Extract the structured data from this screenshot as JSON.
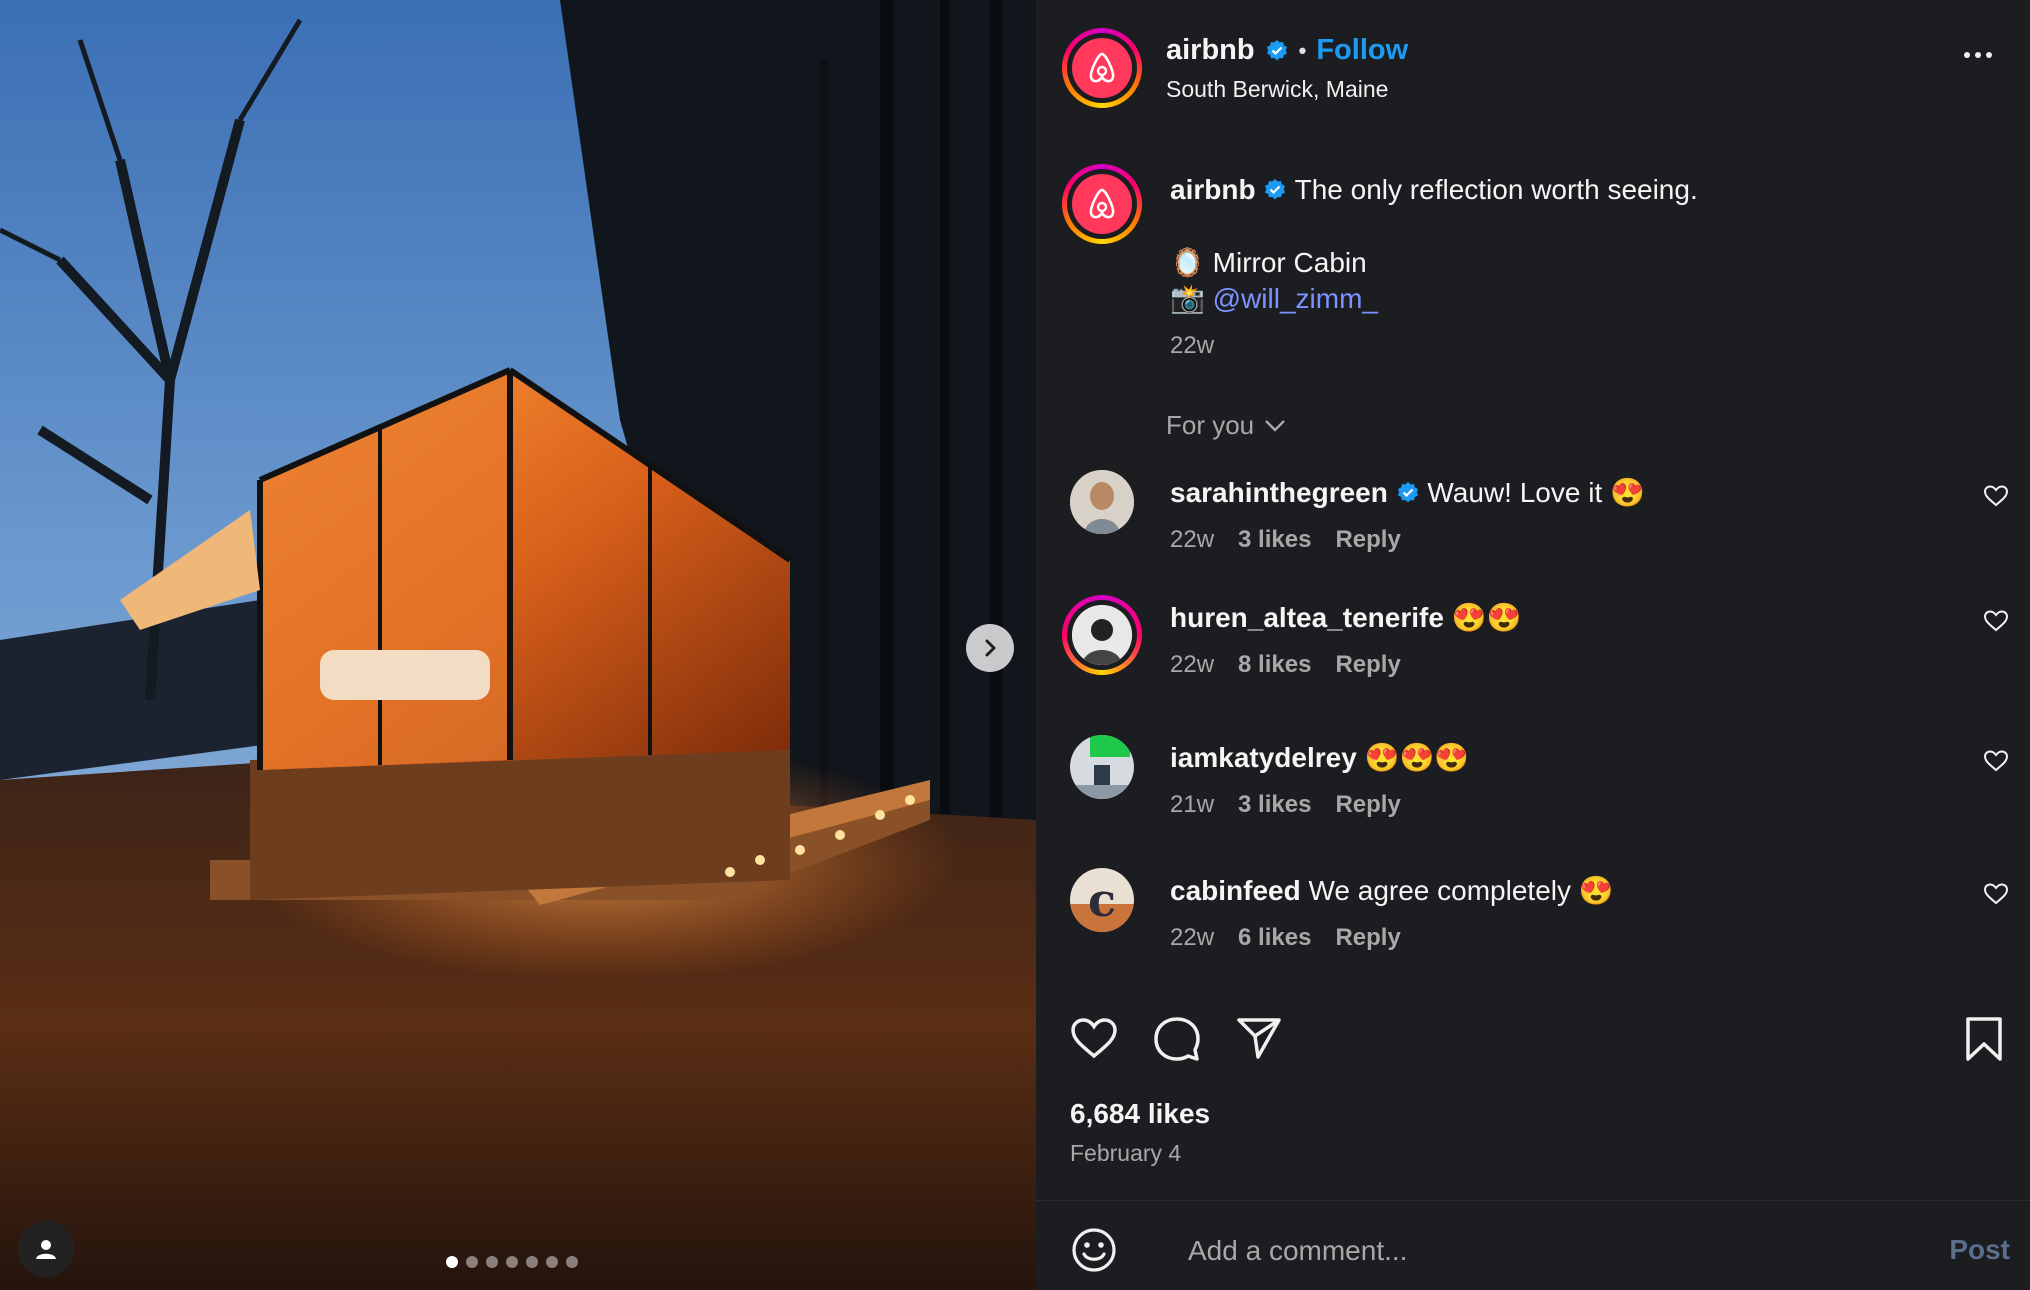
{
  "post": {
    "username": "airbnb",
    "verified": true,
    "follow_label": "Follow",
    "location": "South Berwick, Maine",
    "caption": {
      "text": "The only reflection worth seeing.",
      "line1_emoji": "🪞",
      "line1_text": "Mirror Cabin",
      "line2_emoji": "📸",
      "line2_handle": "@will_zimm_",
      "age": "22w"
    },
    "sort_label": "For you",
    "likes": "6,684 likes",
    "date": "February 4"
  },
  "comments": [
    {
      "username": "sarahinthegreen",
      "verified": true,
      "text": "Wauw! Love it 😍",
      "age": "22w",
      "likes": "3 likes",
      "reply": "Reply"
    },
    {
      "username": "huren_altea_tenerife",
      "verified": false,
      "text": "😍😍",
      "age": "22w",
      "likes": "8 likes",
      "reply": "Reply"
    },
    {
      "username": "iamkatydelrey",
      "verified": false,
      "text": "😍😍😍",
      "age": "21w",
      "likes": "3 likes",
      "reply": "Reply"
    },
    {
      "username": "cabinfeed",
      "verified": false,
      "text": "We agree completely 😍",
      "age": "22w",
      "likes": "6 likes",
      "reply": "Reply"
    }
  ],
  "composer": {
    "placeholder": "Add a comment...",
    "post_label": "Post"
  },
  "carousel": {
    "count": 7,
    "active": 1
  },
  "colors": {
    "brand": "#ff385c",
    "link": "#1c9bf5",
    "mention": "#7d93ff"
  }
}
